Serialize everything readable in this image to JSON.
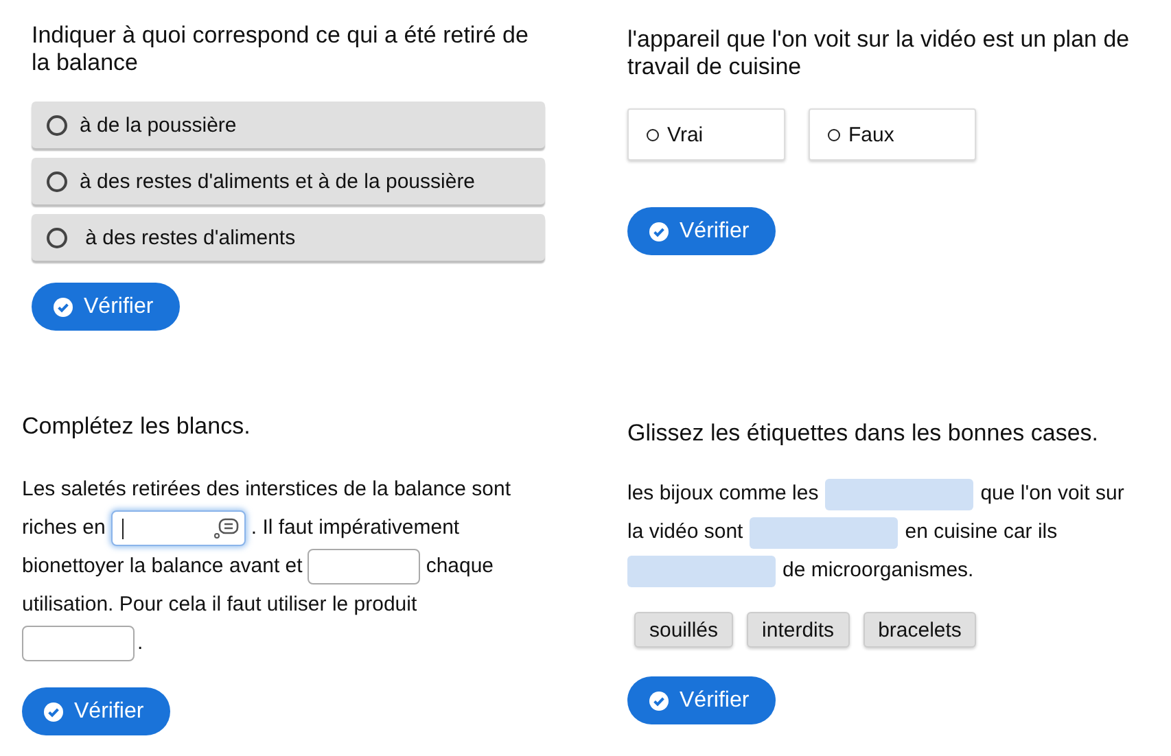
{
  "quiz_choice": {
    "question": "Indiquer à quoi correspond ce qui a été retiré de la balance",
    "options": [
      {
        "label": "à de la poussière",
        "selected": false
      },
      {
        "label": "à des restes d'aliments et à de la poussière",
        "selected": false
      },
      {
        "label": " à des restes d'aliments",
        "selected": false
      }
    ],
    "button": "Vérifier"
  },
  "quiz_true_false": {
    "question": "l'appareil que l'on voit sur la vidéo est un plan de travail de cuisine",
    "options": [
      {
        "label": "Vrai",
        "selected": false
      },
      {
        "label": "Faux",
        "selected": false
      }
    ],
    "button": "Vérifier"
  },
  "quiz_fill_blanks": {
    "title": "Complétez les blancs.",
    "lines": [
      [
        {
          "kind": "text",
          "text": "Les saletés retirées des interstices de la balance sont"
        }
      ],
      [
        {
          "kind": "text",
          "text": "riches en"
        },
        {
          "kind": "blank",
          "focused": true
        },
        {
          "kind": "text",
          "text": ". Il faut impérativement"
        }
      ],
      [
        {
          "kind": "text",
          "text": "bionettoyer la balance avant et"
        },
        {
          "kind": "blank",
          "focused": false
        },
        {
          "kind": "text",
          "text": "chaque"
        }
      ],
      [
        {
          "kind": "text",
          "text": "utilisation. Pour cela il faut utiliser le produit"
        }
      ],
      [
        {
          "kind": "blank",
          "focused": false
        },
        {
          "kind": "text",
          "text": "."
        }
      ]
    ],
    "button": "Vérifier"
  },
  "quiz_drag_labels": {
    "title": "Glissez les étiquettes dans les bonnes cases.",
    "lines": [
      [
        {
          "kind": "text",
          "text": "les bijoux comme les"
        },
        {
          "kind": "drop"
        },
        {
          "kind": "text",
          "text": "que l'on voit sur"
        }
      ],
      [
        {
          "kind": "text",
          "text": "la vidéo sont"
        },
        {
          "kind": "drop"
        },
        {
          "kind": "text",
          "text": "en cuisine car ils"
        }
      ],
      [
        {
          "kind": "drop"
        },
        {
          "kind": "text",
          "text": "de microorganismes."
        }
      ]
    ],
    "labels": [
      "souillés",
      "interdits",
      "bracelets"
    ],
    "button": "Vérifier"
  }
}
